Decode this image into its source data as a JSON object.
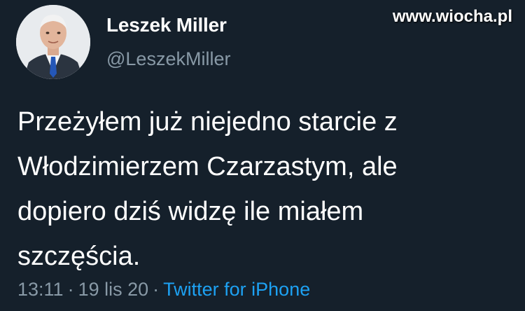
{
  "watermark": "www.wiocha.pl",
  "author": {
    "display_name": "Leszek Miller",
    "handle": "@LeszekMiller",
    "avatar_icon": "profile-photo"
  },
  "tweet": {
    "lines": [
      "Przeżyłem już niejedno starcie z",
      "Włodzimierzem Czarzastym, ale",
      "dopiero dziś widzę ile miałem",
      "szczęścia."
    ],
    "time": "13:11",
    "separator": "·",
    "date": "19 lis 20",
    "source": "Twitter for iPhone"
  },
  "colors": {
    "background": "#15202b",
    "text": "#ffffff",
    "secondary": "#8899a6",
    "link": "#1da1f2"
  }
}
